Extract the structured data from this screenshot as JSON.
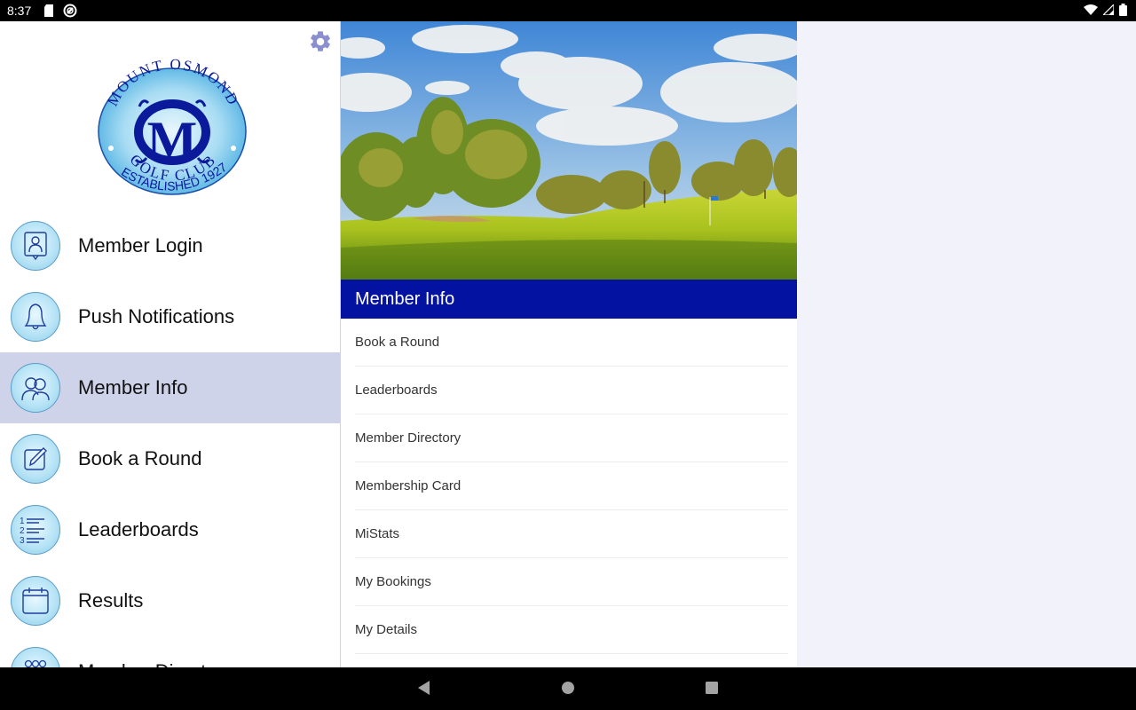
{
  "status_bar": {
    "time": "8:37",
    "left_icons": [
      "sd-card-icon",
      "sync-icon"
    ],
    "right_icons": [
      "wifi-icon",
      "cell-signal-icon",
      "battery-icon"
    ]
  },
  "drawer": {
    "settings_icon": "gear-icon",
    "logo": {
      "top_text": "MOUNT OSMOND",
      "bottom_text": "GOLF CLUB",
      "monogram": "MO",
      "established": "ESTABLISHED 1927"
    },
    "items": [
      {
        "label": "Member Login",
        "icon": "member-login-icon",
        "active": false
      },
      {
        "label": "Push Notifications",
        "icon": "bell-icon",
        "active": false
      },
      {
        "label": "Member Info",
        "icon": "members-icon",
        "active": true
      },
      {
        "label": "Book a Round",
        "icon": "pencil-icon",
        "active": false
      },
      {
        "label": "Leaderboards",
        "icon": "numbered-list-icon",
        "active": false
      },
      {
        "label": "Results",
        "icon": "calendar-icon",
        "active": false
      },
      {
        "label": "Member Directory",
        "icon": "group-icon",
        "active": false
      }
    ]
  },
  "content": {
    "hero_alt": "Golf course fairway with trees under blue sky",
    "header": "Member Info",
    "items": [
      "Book a Round",
      "Leaderboards",
      "Member Directory",
      "Membership Card",
      "MiStats",
      "My Bookings",
      "My Details"
    ]
  },
  "colors": {
    "header_blue": "#0312a0",
    "active_item": "#cfd3e9",
    "settings_gear": "#8a8fd0",
    "background": "#f1f2fa"
  },
  "nav_bar": {
    "buttons": [
      "back",
      "home",
      "recents"
    ]
  }
}
